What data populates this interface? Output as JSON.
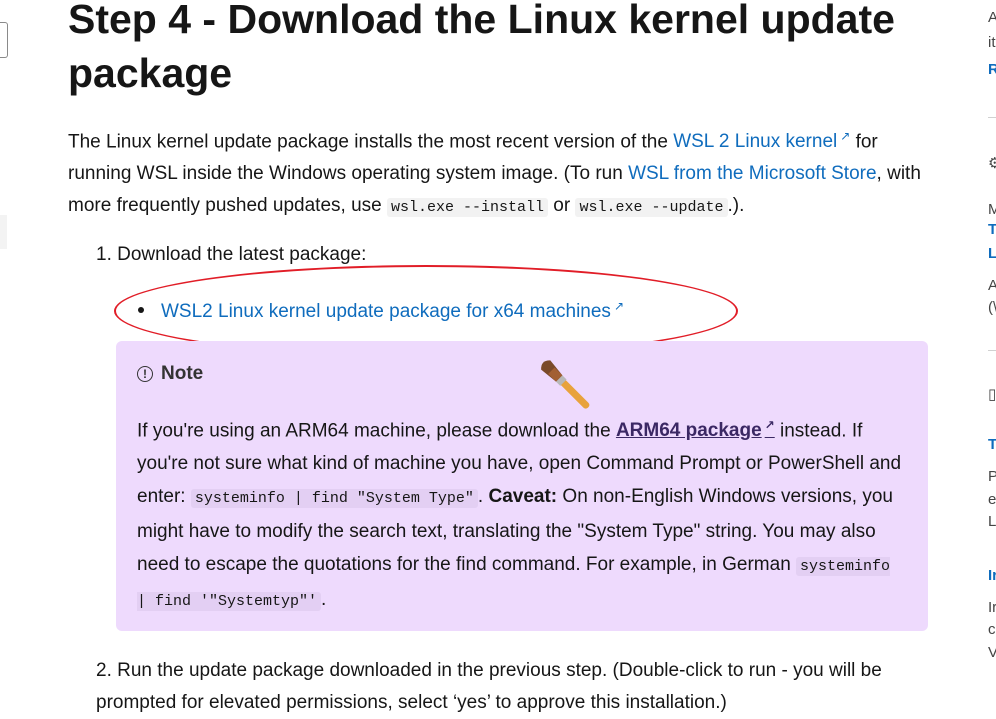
{
  "main": {
    "heading": "Step 4 - Download the Linux kernel update package",
    "intro": {
      "text1": "The Linux kernel update package installs the most recent version of the ",
      "link1": "WSL 2 Linux kernel",
      "text2": " for running WSL inside the Windows operating system image. (To run ",
      "link2": "WSL from the Microsoft Store",
      "text3": ", with more frequently pushed updates, use ",
      "code1": "wsl.exe --install",
      "text4": " or ",
      "code2": "wsl.exe --update",
      "text5": ".)."
    },
    "step1": {
      "label": "1. Download the latest package:",
      "bullet_link": "WSL2 Linux kernel update package for x64 machines"
    },
    "note": {
      "title": "Note",
      "p1": "If you're using an ARM64 machine, please download the ",
      "arm_link": "ARM64 package",
      "p2": " instead. If you're not sure what kind of machine you have, open Command Prompt or PowerShell and enter: ",
      "code1": "systeminfo | find \"System Type\"",
      "p3": ". ",
      "caveat": "Caveat:",
      "p4": " On non-English Windows versions, you might have to modify the search text, translating the \"System Type\" string. You may also need to escape the quotations for the find command. For example, in German ",
      "code2": "systeminfo | find '\"Systemtyp\"'",
      "p5": "."
    },
    "step2": {
      "label": "2. Run the update package downloaded in the previous step. (Double-click to run - you will be prompted for elevated permissions, select ‘yes’ to approve this installation.)"
    }
  },
  "right_column": {
    "l1": "A",
    "l2": "it",
    "l3": "R",
    "l5": "M",
    "l6": "T",
    "l7": "L",
    "l8": "A",
    "l9": "(\\",
    "l11": "T",
    "l12": "P",
    "l13": "e",
    "l14": "L",
    "l15": "Ir",
    "l16": "Ir",
    "l17": "c",
    "l18": "V"
  },
  "colors": {
    "link": "#0f6cbd",
    "note_bg": "#eedafd",
    "annotation": "#e11d27"
  },
  "icons": [
    "info-icon",
    "external-link-icon",
    "paintbrush-icon"
  ]
}
